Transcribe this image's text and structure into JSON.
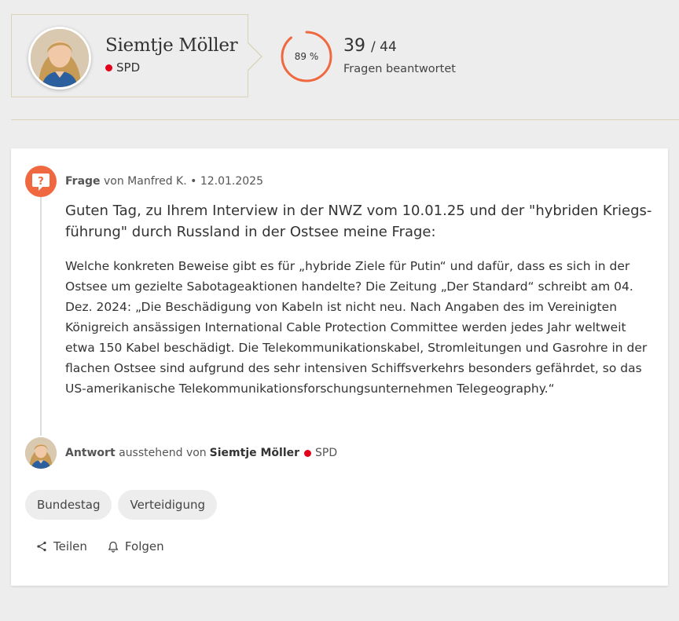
{
  "profile": {
    "name": "Siemtje Möller",
    "party": "SPD",
    "party_color": "#e3001b"
  },
  "stats": {
    "percent_label": "89 %",
    "percent_value": 0.89,
    "answered": "39",
    "total": "/ 44",
    "label": "Fragen beantwortet",
    "ring_color": "#f0683f"
  },
  "question": {
    "label": "Frage",
    "by": "von Manfred K. • 12.01.2025",
    "title": "Guten Tag, zu Ihrem Interview in der NWZ vom 10.01.25 und der \"hybriden Kriegs­führung\" durch Russland in der Ostsee meine Frage:",
    "body": "Welche konkreten Beweise gibt es für „hybride Ziele für Putin“ und dafür, dass es sich in der Ostsee um gezielte Sabotageaktionen handelte? Die Zeitung „Der Standard“ schreibt am 04. Dez. 2024: „Die Beschädigung von Kabeln ist nicht neu. Nach Angaben des im Verei­nigten Königreich ansässigen International Cable Protection Committee werden jedes Jahr weltweit etwa 150 Kabel beschädigt. Die Telekommunikationskabel, Stromleitungen und Gasrohre in der flachen Ostsee sind aufgrund des sehr intensiven Schiffsverkehrs beson­ders gefährdet, so das US-amerikanische Telekommunikationsforschungsunternehmen Te­legeography.“",
    "icon": "question-bubble-icon",
    "accent": "#f0683f"
  },
  "answer": {
    "label": "Antwort",
    "status": "ausstehend von",
    "name": "Siemtje Möller",
    "party": "SPD"
  },
  "tags": [
    "Bundestag",
    "Verteidigung"
  ],
  "actions": {
    "share": "Teilen",
    "follow": "Folgen"
  }
}
